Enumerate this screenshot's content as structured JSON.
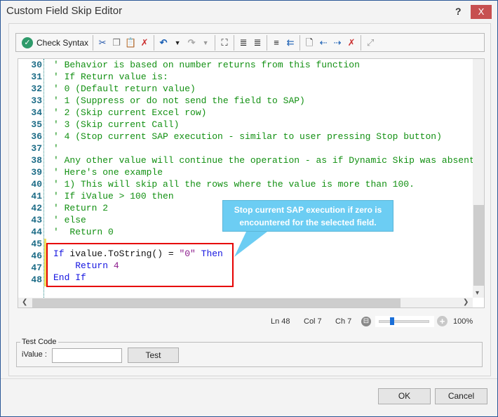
{
  "window": {
    "title": "Custom Field Skip Editor",
    "help": "?",
    "close": "X"
  },
  "toolbar": {
    "check_syntax": "Check Syntax",
    "icons": [
      "cut-icon",
      "copy-icon",
      "paste-icon",
      "clear-icon",
      "undo-icon",
      "redo-icon",
      "find-icon",
      "indent-icon",
      "outdent-icon",
      "comment-icon",
      "uncomment-icon",
      "bookmark-icon",
      "prev-bookmark-icon",
      "next-bookmark-icon",
      "clear-bookmarks-icon",
      "fullscreen-icon"
    ]
  },
  "editor": {
    "lines": [
      {
        "n": "30",
        "t": "' Behavior is based on number returns from this function"
      },
      {
        "n": "31",
        "t": "' If Return value is:"
      },
      {
        "n": "32",
        "t": "' 0 (Default return value)"
      },
      {
        "n": "33",
        "t": "' 1 (Suppress or do not send the field to SAP)"
      },
      {
        "n": "34",
        "t": "' 2 (Skip current Excel row)"
      },
      {
        "n": "35",
        "t": "' 3 (Skip current Call)"
      },
      {
        "n": "36",
        "t": "' 4 (Stop current SAP execution - similar to user pressing Stop button)"
      },
      {
        "n": "37",
        "t": "'"
      },
      {
        "n": "38",
        "t": "' Any other value will continue the operation - as if Dynamic Skip was absent"
      },
      {
        "n": "39",
        "t": "' Here's one example"
      },
      {
        "n": "40",
        "t": "' 1) This will skip all the rows where the value is more than 100."
      },
      {
        "n": "41",
        "t": "' If iValue > 100 then"
      },
      {
        "n": "42",
        "t": "' Return 2"
      },
      {
        "n": "43",
        "t": "' else"
      },
      {
        "n": "44",
        "t": "'  Return 0"
      },
      {
        "n": "45",
        "t": ""
      },
      {
        "n": "46",
        "t": ""
      },
      {
        "n": "47",
        "t": ""
      },
      {
        "n": "48",
        "t": ""
      }
    ],
    "code46": {
      "k1": "If",
      "t1": " ivalue.ToString() = ",
      "s": "\"0\"",
      "k2": " Then"
    },
    "code47": {
      "k": "    Return",
      "n": " 4"
    },
    "code48": {
      "k": "End If"
    }
  },
  "callout": {
    "line1": "Stop current SAP execution if zero is",
    "line2": "encountered for the selected field."
  },
  "status": {
    "ln": "Ln 48",
    "col": "Col 7",
    "ch": "Ch 7",
    "zoom": "100%",
    "zoom_level": 100
  },
  "test": {
    "group": "Test Code",
    "label": "iValue :",
    "value": "",
    "button": "Test"
  },
  "footer": {
    "ok": "OK",
    "cancel": "Cancel"
  }
}
